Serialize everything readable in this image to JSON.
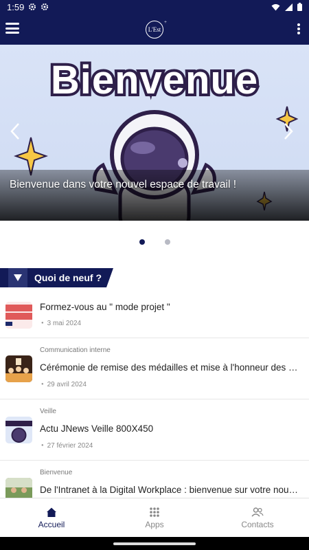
{
  "status_bar": {
    "time": "1:59"
  },
  "app_bar": {
    "logo_text": "L'Est",
    "logo_plus": "+"
  },
  "carousel": {
    "title": "Bienvenue",
    "caption": "Bienvenue dans votre nouvel espace de travail !",
    "slide_count": 2,
    "active_slide": 1
  },
  "section": {
    "title": "Quoi de neuf ?"
  },
  "news": [
    {
      "category": "",
      "title": "Formez-vous au \" mode projet \"",
      "date": "3 mai 2024",
      "thumb_text": "mode projet ! tre service !"
    },
    {
      "category": "Communication interne",
      "title": "Cérémonie de remise des médailles et mise à l'honneur des retraités",
      "date": "29 avril 2024",
      "thumb_text": ""
    },
    {
      "category": "Veille",
      "title": "Actu JNews Veille 800X450",
      "date": "27 février 2024",
      "thumb_text": "Bienvenu"
    },
    {
      "category": "Bienvenue",
      "title": "De l'Intranet à la Digital Workplace : bienvenue sur votre nouvelle",
      "date": "",
      "thumb_text": ""
    }
  ],
  "bottom_nav": [
    {
      "label": "Accueil",
      "icon": "home-icon",
      "active": true
    },
    {
      "label": "Apps",
      "icon": "apps-grid-icon",
      "active": false
    },
    {
      "label": "Contacts",
      "icon": "contacts-icon",
      "active": false
    }
  ],
  "colors": {
    "primary": "#121a57",
    "inactive": "#888888"
  }
}
